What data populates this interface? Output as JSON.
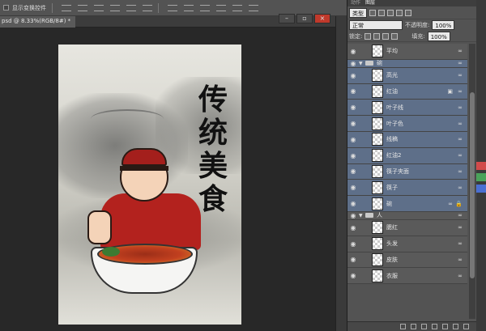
{
  "options_bar": {
    "checkbox_label": "显示变换控件"
  },
  "document": {
    "tab_title": "psd @ 8.33%(RGB/8#) *"
  },
  "artwork": {
    "calligraphy": [
      "传",
      "统",
      "美",
      "食"
    ]
  },
  "layers_panel": {
    "tabs": [
      "动作",
      "图层"
    ],
    "active_tab": "图层",
    "filter_type": "类型",
    "blend_mode": "正常",
    "opacity_label": "不透明度:",
    "opacity_value": "100%",
    "lock_label": "锁定:",
    "fill_label": "填充:",
    "fill_value": "100%",
    "layers": [
      {
        "name": "平均",
        "kind": "layer",
        "selected": false
      },
      {
        "name": "碗",
        "kind": "group",
        "selected": true
      },
      {
        "name": "高光",
        "kind": "layer",
        "selected": true
      },
      {
        "name": "红油",
        "kind": "layer",
        "selected": true,
        "fx": true
      },
      {
        "name": "叶子线",
        "kind": "layer",
        "selected": true
      },
      {
        "name": "叶子色",
        "kind": "layer",
        "selected": true
      },
      {
        "name": "线稿",
        "kind": "layer",
        "selected": true
      },
      {
        "name": "红油2",
        "kind": "layer",
        "selected": true
      },
      {
        "name": "筷子夹面",
        "kind": "layer",
        "selected": true
      },
      {
        "name": "筷子",
        "kind": "layer",
        "selected": true
      },
      {
        "name": "碗",
        "kind": "layer",
        "selected": true,
        "locked": true
      },
      {
        "name": "人",
        "kind": "group",
        "selected": false
      },
      {
        "name": "腮红",
        "kind": "layer",
        "selected": false
      },
      {
        "name": "头发",
        "kind": "layer",
        "selected": false
      },
      {
        "name": "皮肤",
        "kind": "layer",
        "selected": false
      },
      {
        "name": "衣服",
        "kind": "layer",
        "selected": false
      }
    ]
  },
  "colors": {
    "panel_bg": "#535353",
    "selected_layer": "#5e6f89",
    "canvas_bg": "#282828"
  }
}
